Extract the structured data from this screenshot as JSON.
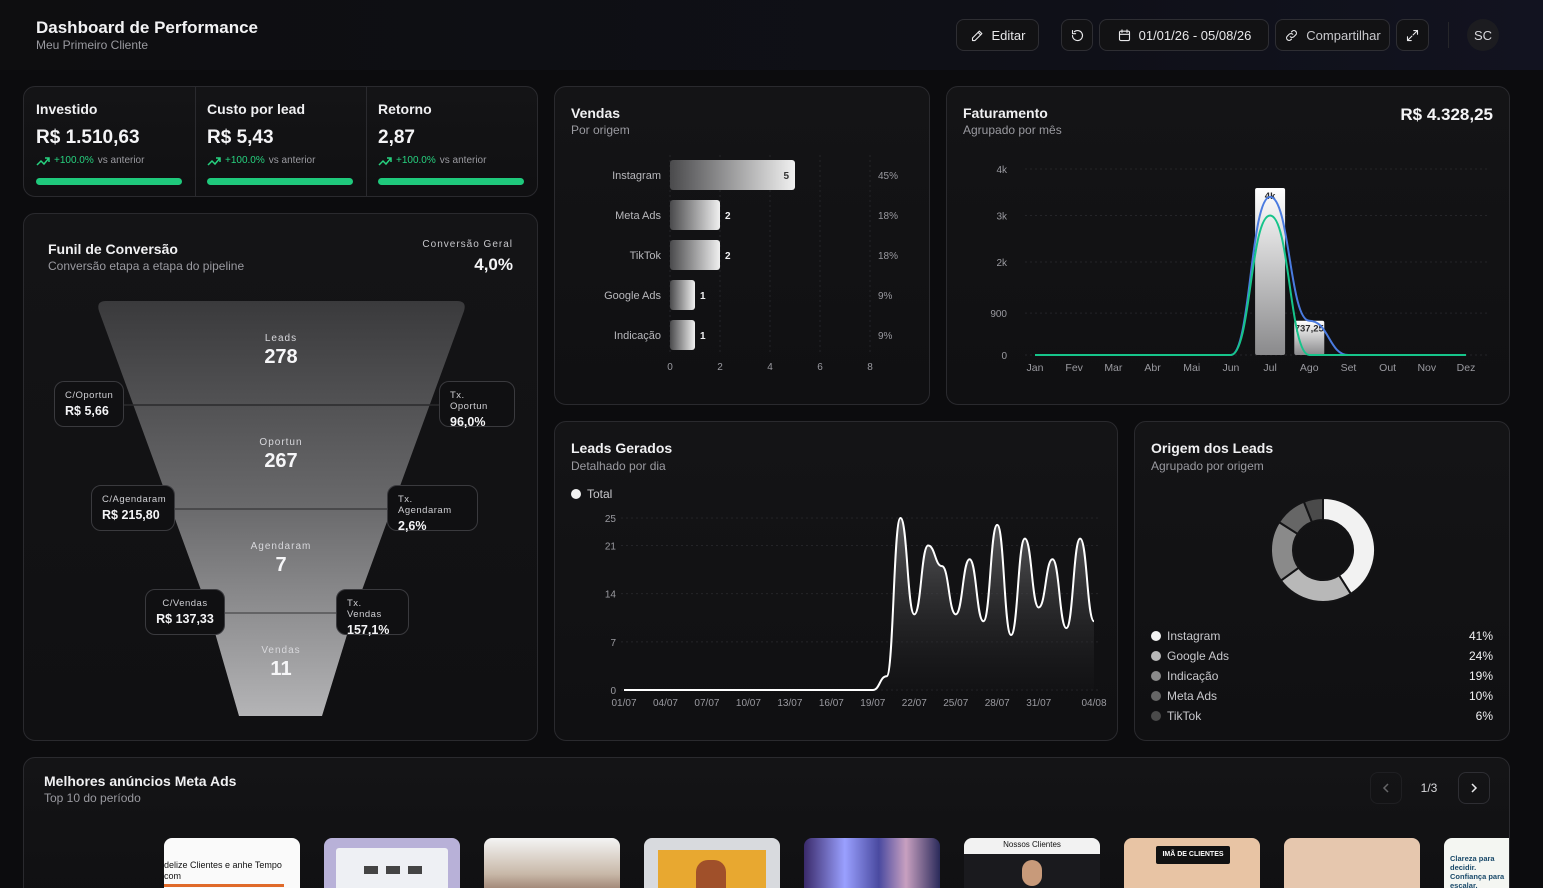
{
  "header": {
    "title": "Dashboard de Performance",
    "subtitle": "Meu Primeiro Cliente",
    "edit_label": "Editar",
    "date_range": "01/01/26 - 05/08/26",
    "share_label": "Compartilhar",
    "avatar_initials": "SC"
  },
  "kpis": [
    {
      "label": "Investido",
      "value": "R$ 1.510,63",
      "trend": "+100.0%",
      "trend_suffix": "vs anterior",
      "progress": 1.0
    },
    {
      "label": "Custo por lead",
      "value": "R$ 5,43",
      "trend": "+100.0%",
      "trend_suffix": "vs anterior",
      "progress": 1.0
    },
    {
      "label": "Retorno",
      "value": "2,87",
      "trend": "+100.0%",
      "trend_suffix": "vs anterior",
      "progress": 1.0
    }
  ],
  "funnel": {
    "title": "Funil de Conversão",
    "subtitle": "Conversão etapa a etapa do pipeline",
    "overall_label": "Conversão Geral",
    "overall_value": "4,0%",
    "stages": [
      {
        "label": "Leads",
        "value": "278"
      },
      {
        "label": "Oportun",
        "value": "267"
      },
      {
        "label": "Agendaram",
        "value": "7"
      },
      {
        "label": "Vendas",
        "value": "11"
      }
    ],
    "cost_badges": [
      {
        "label": "C/Oportun",
        "value": "R$ 5,66"
      },
      {
        "label": "C/Agendaram",
        "value": "R$ 215,80"
      },
      {
        "label": "C/Vendas",
        "value": "R$ 137,33"
      }
    ],
    "rate_badges": [
      {
        "label": "Tx. Oportun",
        "value": "96,0%"
      },
      {
        "label": "Tx. Agendaram",
        "value": "2,6%"
      },
      {
        "label": "Tx. Vendas",
        "value": "157,1%"
      }
    ]
  },
  "vendas": {
    "title": "Vendas",
    "subtitle": "Por origem"
  },
  "faturamento": {
    "title": "Faturamento",
    "subtitle": "Agrupado por mês",
    "total": "R$ 4.328,25"
  },
  "leads": {
    "title": "Leads Gerados",
    "subtitle": "Detalhado por dia",
    "legend": "Total"
  },
  "origem": {
    "title": "Origem dos Leads",
    "subtitle": "Agrupado por origem"
  },
  "ads": {
    "title": "Melhores anúncios Meta Ads",
    "subtitle": "Top 10 do período",
    "page": "1/3",
    "thumb_texts": [
      "delize Clientes e anhe Tempo com",
      "Nossos Clientes",
      "IMÃ DE CLIENTES",
      "Clareza para decidir. Confiança para escalar."
    ]
  },
  "colors": {
    "accent_green": "#1fc97c",
    "line_blue": "#4a7be0",
    "line_green": "#16c48a",
    "card_bg": "#141416"
  },
  "icons": [
    "pencil-icon",
    "refresh-icon",
    "calendar-icon",
    "link-icon",
    "expand-icon",
    "trend-up-icon",
    "chevron-left-icon",
    "chevron-right-icon"
  ],
  "chart_data": [
    {
      "id": "vendas",
      "type": "bar",
      "orientation": "horizontal",
      "categories": [
        "Instagram",
        "Meta Ads",
        "TikTok",
        "Google Ads",
        "Indicação"
      ],
      "values": [
        5,
        2,
        2,
        1,
        1
      ],
      "percent_labels": [
        "45%",
        "18%",
        "18%",
        "9%",
        "9%"
      ],
      "xticks": [
        0,
        2,
        4,
        6,
        8
      ],
      "xlim": [
        0,
        8
      ],
      "grid": true
    },
    {
      "id": "faturamento",
      "type": "bar",
      "categories": [
        "Jan",
        "Fev",
        "Mar",
        "Abr",
        "Mai",
        "Jun",
        "Jul",
        "Ago",
        "Set",
        "Out",
        "Nov",
        "Dez"
      ],
      "values": [
        0,
        0,
        0,
        0,
        0,
        0,
        3591,
        737.25,
        0,
        0,
        0,
        0
      ],
      "bar_labels": {
        "Jul": "4k",
        "Ago": "737,25"
      },
      "yticks": [
        0,
        900,
        2000,
        3000,
        4000
      ],
      "ytick_labels": [
        "0",
        "900",
        "2k",
        "3k",
        "4k"
      ],
      "ylim": [
        0,
        4000
      ],
      "series": [
        {
          "color": "#4a7be0",
          "values": [
            0,
            0,
            0,
            0,
            0,
            0,
            3400,
            737.25,
            0,
            0,
            0,
            0
          ]
        },
        {
          "color": "#16c48a",
          "values": [
            0,
            0,
            0,
            0,
            0,
            0,
            3000,
            0,
            0,
            0,
            0,
            0
          ]
        }
      ],
      "grid": true
    },
    {
      "id": "leads",
      "type": "area",
      "x": [
        "01/07",
        "02/07",
        "03/07",
        "04/07",
        "05/07",
        "06/07",
        "07/07",
        "08/07",
        "09/07",
        "10/07",
        "11/07",
        "12/07",
        "13/07",
        "14/07",
        "15/07",
        "16/07",
        "17/07",
        "18/07",
        "19/07",
        "20/07",
        "21/07",
        "22/07",
        "23/07",
        "24/07",
        "25/07",
        "26/07",
        "27/07",
        "28/07",
        "29/07",
        "30/07",
        "31/07",
        "01/08",
        "02/08",
        "03/08",
        "04/08"
      ],
      "xtick_labels": [
        "01/07",
        "04/07",
        "07/07",
        "10/07",
        "13/07",
        "16/07",
        "19/07",
        "22/07",
        "25/07",
        "28/07",
        "31/07",
        "04/08"
      ],
      "series": [
        {
          "name": "Total",
          "values": [
            0,
            0,
            0,
            0,
            0,
            0,
            0,
            0,
            0,
            0,
            0,
            0,
            0,
            0,
            0,
            0,
            0,
            0,
            0,
            2,
            25,
            11,
            21,
            18,
            11,
            19,
            10,
            24,
            8,
            22,
            12,
            19,
            9,
            22,
            10
          ]
        }
      ],
      "yticks": [
        0,
        7,
        14,
        21,
        25
      ],
      "ylim": [
        0,
        25
      ],
      "grid": true
    },
    {
      "id": "origem",
      "type": "pie",
      "donut": true,
      "labels": [
        "Instagram",
        "Google Ads",
        "Indicação",
        "Meta Ads",
        "TikTok"
      ],
      "values": [
        41,
        24,
        19,
        10,
        6
      ],
      "value_labels": [
        "41%",
        "24%",
        "19%",
        "10%",
        "6%"
      ],
      "colors": [
        "#f2f2f2",
        "#b8b8b8",
        "#8a8a8a",
        "#666666",
        "#4a4a4a"
      ]
    }
  ]
}
